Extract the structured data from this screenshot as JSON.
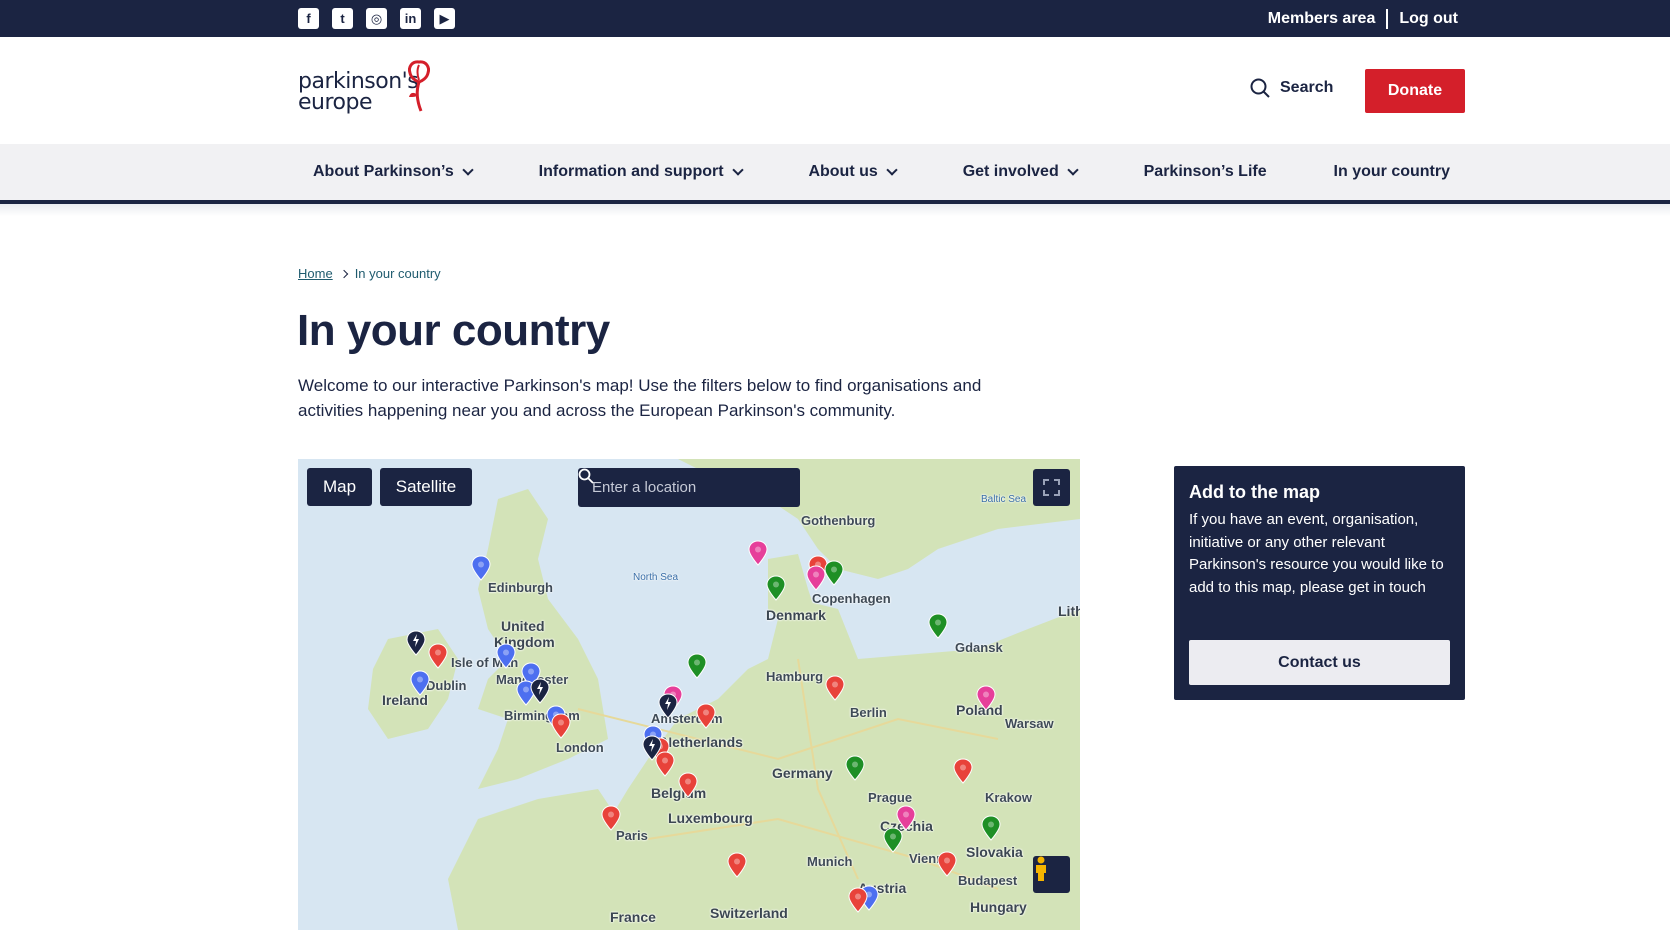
{
  "topbar": {
    "social": [
      {
        "icon": "facebook-icon",
        "glyph": "f"
      },
      {
        "icon": "twitter-icon",
        "glyph": "t"
      },
      {
        "icon": "instagram-icon",
        "glyph": "◎"
      },
      {
        "icon": "linkedin-icon",
        "glyph": "in"
      },
      {
        "icon": "youtube-icon",
        "glyph": "▶"
      }
    ],
    "members_label": "Members area",
    "logout_label": "Log out"
  },
  "header": {
    "logo_line1": "parkinson's",
    "logo_line2": "europe",
    "search_label": "Search",
    "donate_label": "Donate"
  },
  "nav": {
    "items": [
      {
        "label": "About Parkinson’s",
        "dropdown": true
      },
      {
        "label": "Information and support",
        "dropdown": true
      },
      {
        "label": "About us",
        "dropdown": true
      },
      {
        "label": "Get involved",
        "dropdown": true
      },
      {
        "label": "Parkinson’s Life",
        "dropdown": false
      },
      {
        "label": "In your country",
        "dropdown": false
      }
    ]
  },
  "breadcrumb": {
    "home": "Home",
    "current": "In your country"
  },
  "page": {
    "title": "In your country",
    "intro": "Welcome to our interactive Parkinson's map! Use the filters below to find organisations and activities happening near you and across the European Parkinson's community."
  },
  "map": {
    "map_label": "Map",
    "satellite_label": "Satellite",
    "search_placeholder": "Enter a location",
    "labels": {
      "edinburgh": "Edinburgh",
      "united": "United",
      "kingdom": "Kingdom",
      "isle_of_man": "Isle of Man",
      "dublin": "Dublin",
      "ireland": "Ireland",
      "manchester": "Manchester",
      "birmingham": "Birmingham",
      "london": "London",
      "north_sea": "North Sea",
      "baltic_sea": "Baltic Sea",
      "gothenburg": "Gothenburg",
      "denmark": "Denmark",
      "copenhagen": "Copenhagen",
      "hamburg": "Hamburg",
      "amsterdam": "Amsterdam",
      "netherlands": "Netherlands",
      "belgium": "Belgium",
      "luxembourg": "Luxembourg",
      "paris": "Paris",
      "germany": "Germany",
      "berlin": "Berlin",
      "gdansk": "Gdansk",
      "poland": "Poland",
      "warsaw": "Warsaw",
      "prague": "Prague",
      "krakow": "Krakow",
      "czechia": "Czechia",
      "slovakia": "Slovakia",
      "vienna": "Vienna",
      "munich": "Munich",
      "austria": "Austria",
      "budapest": "Budapest",
      "hungary": "Hungary",
      "switzerland": "Switzerland",
      "france": "France",
      "lithuania_partial": "Lith"
    },
    "pin_colors": {
      "red": "#e8423a",
      "blue": "#4d6ff0",
      "green": "#1e8f25",
      "pink": "#e63f9a",
      "dark": "#1b2442"
    }
  },
  "card": {
    "title": "Add to the map",
    "text": "If you have an event, organisation, initiative or any other relevant Parkinson's resource you would like to add to this map, please get in touch",
    "button": "Contact us"
  }
}
